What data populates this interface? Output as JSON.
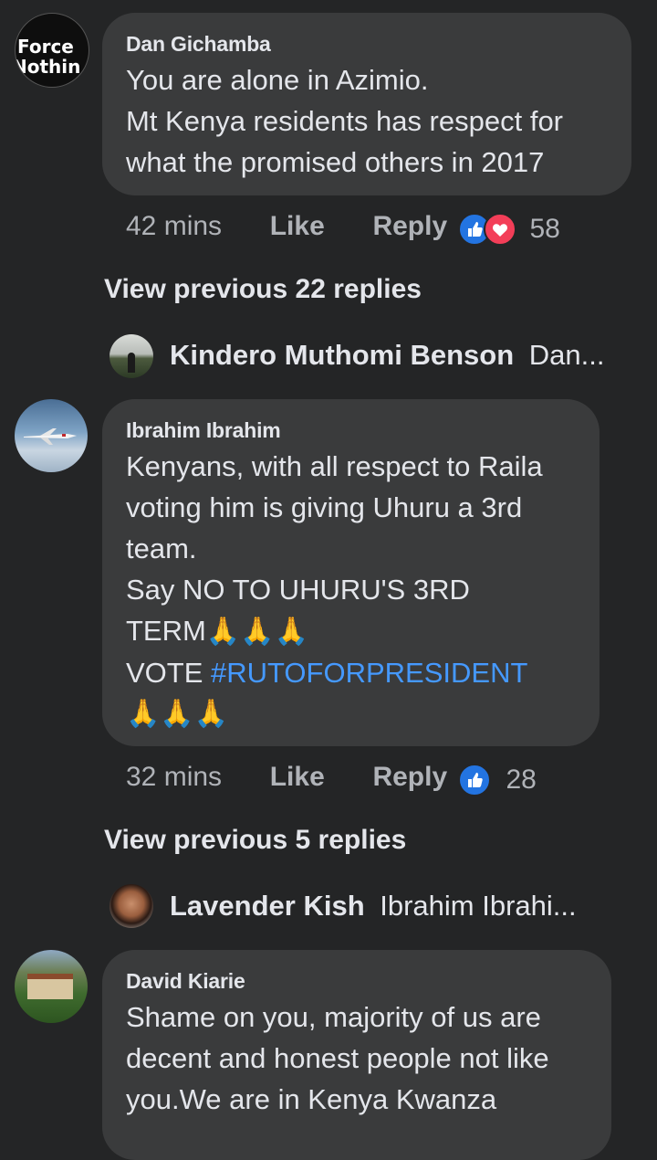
{
  "comments": [
    {
      "author": "Dan Gichamba",
      "avatar_text": [
        "Force",
        "Nothin"
      ],
      "lines": [
        "You are alone in Azimio.",
        "Mt Kenya residents has respect for",
        "what the promised others in 2017"
      ],
      "time": "42 mins",
      "like_label": "Like",
      "reply_label": "Reply",
      "reaction_count": "58",
      "reactions": [
        "like-icon",
        "love-icon"
      ]
    },
    {
      "author": "Ibrahim Ibrahim",
      "lines": [
        "Kenyans, with all respect to Raila",
        "voting him is giving Uhuru a 3rd",
        "team.",
        "Say NO TO UHURU'S 3RD",
        "TERM"
      ],
      "pray": "🙏🙏🙏",
      "vote_label": "VOTE",
      "hashtag": "#RUTOFORPRESIDENT",
      "time": "32 mins",
      "like_label": "Like",
      "reply_label": "Reply",
      "reaction_count": "28",
      "reactions": [
        "like-icon"
      ]
    },
    {
      "author": "David Kiarie",
      "lines": [
        "Shame on you, majority of us are",
        "decent and honest people not like",
        "you.We are in Kenya Kwanza"
      ]
    }
  ],
  "view_previous": [
    {
      "label": "View previous 22 replies"
    },
    {
      "label": "View previous 5 replies"
    }
  ],
  "reply_previews": [
    {
      "name": "Kindero Muthomi Benson",
      "preview": "Dan..."
    },
    {
      "name": "Lavender Kish",
      "preview": "Ibrahim Ibrahi..."
    }
  ],
  "colors": {
    "background": "#242526",
    "bubble": "#3a3b3c",
    "text": "#e4e6eb",
    "secondary": "#b0b3b8",
    "link": "#4599ff",
    "like_blue": "#2374e1",
    "love_red": "#f33e58"
  }
}
